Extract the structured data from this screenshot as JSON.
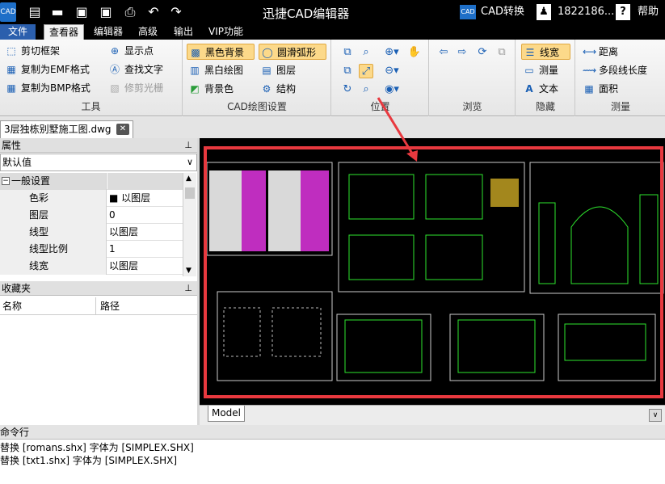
{
  "titlebar": {
    "logo": "CAD",
    "title": "迅捷CAD编辑器",
    "convert_logo": "CAD",
    "convert_label": "CAD转换",
    "user_label": "1822186...",
    "help_label": "帮助"
  },
  "menu": {
    "file": "文件",
    "tabs": [
      "查看器",
      "编辑器",
      "高级",
      "输出",
      "VIP功能"
    ]
  },
  "ribbon": {
    "tools": {
      "title": "工具",
      "items": [
        "剪切框架",
        "复制为EMF格式",
        "复制为BMP格式",
        "显示点",
        "查找文字",
        "修剪光栅"
      ]
    },
    "cad_settings": {
      "title": "CAD绘图设置",
      "items": [
        "黑色背景",
        "黑白绘图",
        "背景色",
        "圆滑弧形",
        "图层",
        "结构"
      ]
    },
    "position": {
      "title": "位置"
    },
    "browse": {
      "title": "浏览"
    },
    "hide": {
      "title": "隐藏",
      "items": [
        "线宽",
        "测量",
        "文本"
      ]
    },
    "measure": {
      "title": "测量",
      "items": [
        "距离",
        "多段线长度",
        "面积"
      ]
    }
  },
  "document": {
    "tab_label": "3层独栋别墅施工图.dwg",
    "close": "✕"
  },
  "properties": {
    "header": "属性",
    "selector": "默认值",
    "group": "一般设置",
    "rows": [
      {
        "key": "色彩",
        "value": "■ 以图层"
      },
      {
        "key": "图层",
        "value": "0"
      },
      {
        "key": "线型",
        "value": "以图层"
      },
      {
        "key": "线型比例",
        "value": "1"
      },
      {
        "key": "线宽",
        "value": "以图层"
      }
    ]
  },
  "favorites": {
    "header": "收藏夹",
    "col_name": "名称",
    "col_path": "路径"
  },
  "model_tab": "Model",
  "command": {
    "header": "命令行",
    "lines": [
      "替换 [romans.shx] 字体为 [SIMPLEX.SHX]",
      "替换 [txt1.shx] 字体为 [SIMPLEX.SHX]"
    ]
  },
  "colors": {
    "highlight": "#e8393f",
    "canvas": "#000000",
    "accent": "#1a5fb4"
  }
}
